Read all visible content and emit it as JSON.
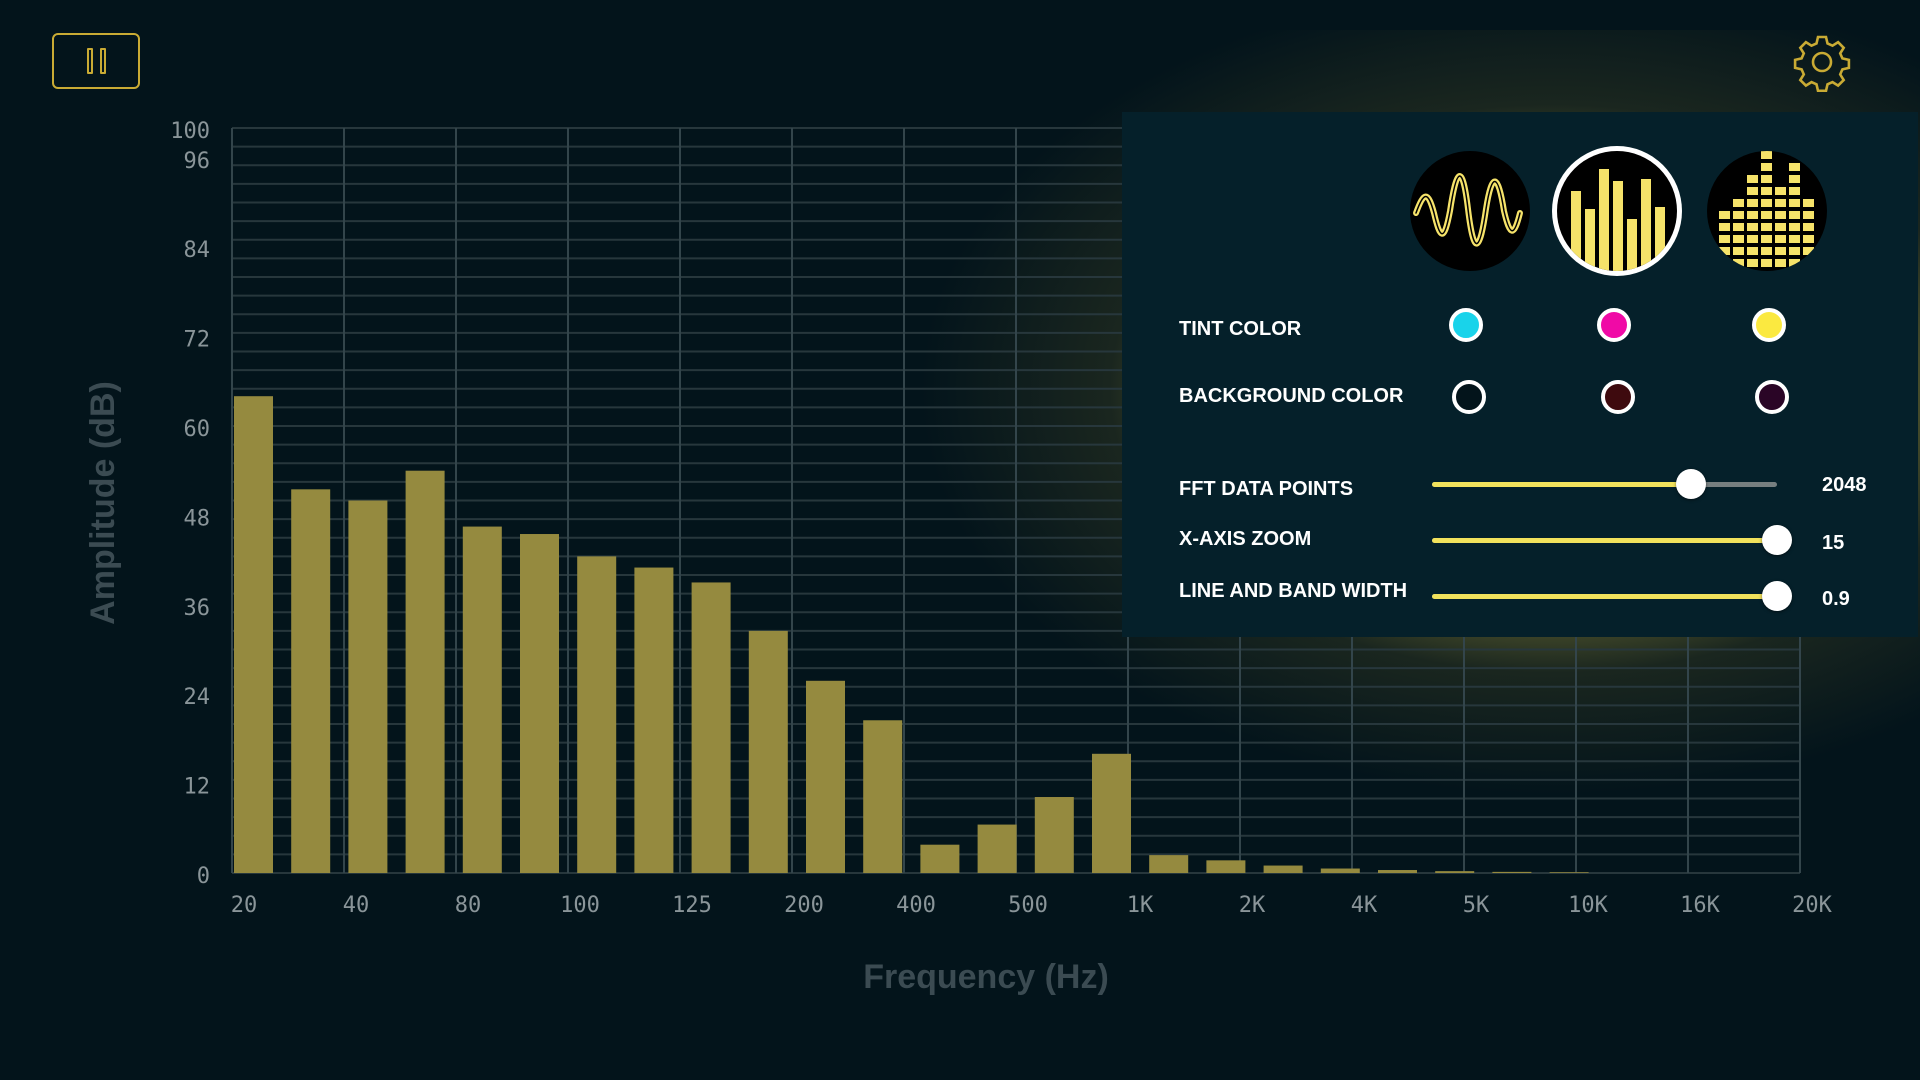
{
  "controls": {
    "pause_icon": "pause-icon",
    "settings_icon": "gear-icon"
  },
  "colors": {
    "bar": "#958a3f",
    "grid": "#27373c",
    "axis_text": "#8a9599",
    "accent": "#f2e25c",
    "frame_gold": "#c9ab34"
  },
  "chart_data": {
    "type": "bar",
    "xlabel": "Frequency (Hz)",
    "ylabel": "Amplitude (dB)",
    "ylim": [
      0,
      100
    ],
    "yticks": [
      "0",
      "12",
      "24",
      "36",
      "48",
      "60",
      "72",
      "84",
      "96",
      "100"
    ],
    "xticks": [
      "20",
      "40",
      "80",
      "100",
      "125",
      "200",
      "400",
      "500",
      "1K",
      "2K",
      "4K",
      "5K",
      "10K",
      "16K",
      "20K"
    ],
    "values": [
      64,
      51.5,
      50,
      54,
      46.5,
      45.5,
      42.5,
      41,
      39,
      32.5,
      25.8,
      20.5,
      3.8,
      6.5,
      10.2,
      16,
      2.4,
      1.7,
      1,
      0.6,
      0.4,
      0.25,
      0.15,
      0.1
    ],
    "grid": true
  },
  "settings": {
    "modes": [
      {
        "name": "waveform",
        "icon": "waveform-icon",
        "selected": false
      },
      {
        "name": "bars",
        "icon": "bar-spectrum-icon",
        "selected": true
      },
      {
        "name": "segmented",
        "icon": "segmented-bars-icon",
        "selected": false
      }
    ],
    "tint_label": "TINT COLOR",
    "tint_colors": [
      "#19d3ea",
      "#f00aa6",
      "#fbe940"
    ],
    "background_label": "BACKGROUND COLOR",
    "background_colors": [
      "#03141b",
      "#3e0a0e",
      "#2a0526"
    ],
    "sliders": [
      {
        "label": "FFT DATA POINTS",
        "value": "2048",
        "fraction": 0.75
      },
      {
        "label": "X-AXIS ZOOM",
        "value": "15",
        "fraction": 1.0
      },
      {
        "label": "LINE AND BAND WIDTH",
        "value": "0.9",
        "fraction": 1.0
      }
    ]
  }
}
